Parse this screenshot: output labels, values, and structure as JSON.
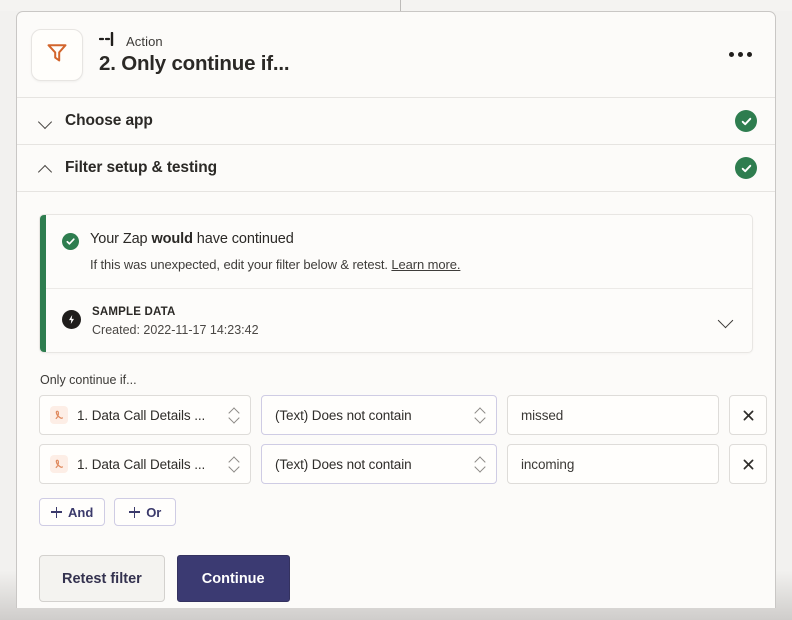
{
  "header": {
    "app_icon": "filter-icon",
    "kicker_icon": "action-step-icon",
    "kicker": "Action",
    "title": "2. Only continue if...",
    "menu_icon": "more-options-icon"
  },
  "accordions": [
    {
      "title": "Choose app",
      "expanded": false,
      "status": "complete"
    },
    {
      "title": "Filter setup & testing",
      "expanded": true,
      "status": "complete"
    }
  ],
  "banner": {
    "status_icon": "check-circle-icon",
    "title_before": "Your Zap ",
    "title_bold": "would",
    "title_after": " have continued",
    "subtitle": "If this was unexpected, edit your filter below & retest.",
    "link": "Learn more.",
    "sample_icon": "zapier-bolt-icon",
    "sample_label": "SAMPLE DATA",
    "sample_created": "Created: 2022-11-17 14:23:42",
    "expand_icon": "chevron-down-icon"
  },
  "filter": {
    "label": "Only continue if...",
    "rows": [
      {
        "field": "1. Data Call Details ...",
        "field_icon": "data-field-icon",
        "condition": "(Text) Does not contain",
        "value": "missed",
        "remove_icon": "close-icon"
      },
      {
        "field": "1. Data Call Details ...",
        "field_icon": "data-field-icon",
        "condition": "(Text) Does not contain",
        "value": "incoming",
        "remove_icon": "close-icon"
      }
    ],
    "add_and": "And",
    "add_or": "Or"
  },
  "actions": {
    "retest": "Retest filter",
    "continue": "Continue"
  },
  "colors": {
    "accent_purple": "#3b3a72",
    "success_green": "#2e7d4f",
    "filter_orange": "#d2652c"
  }
}
